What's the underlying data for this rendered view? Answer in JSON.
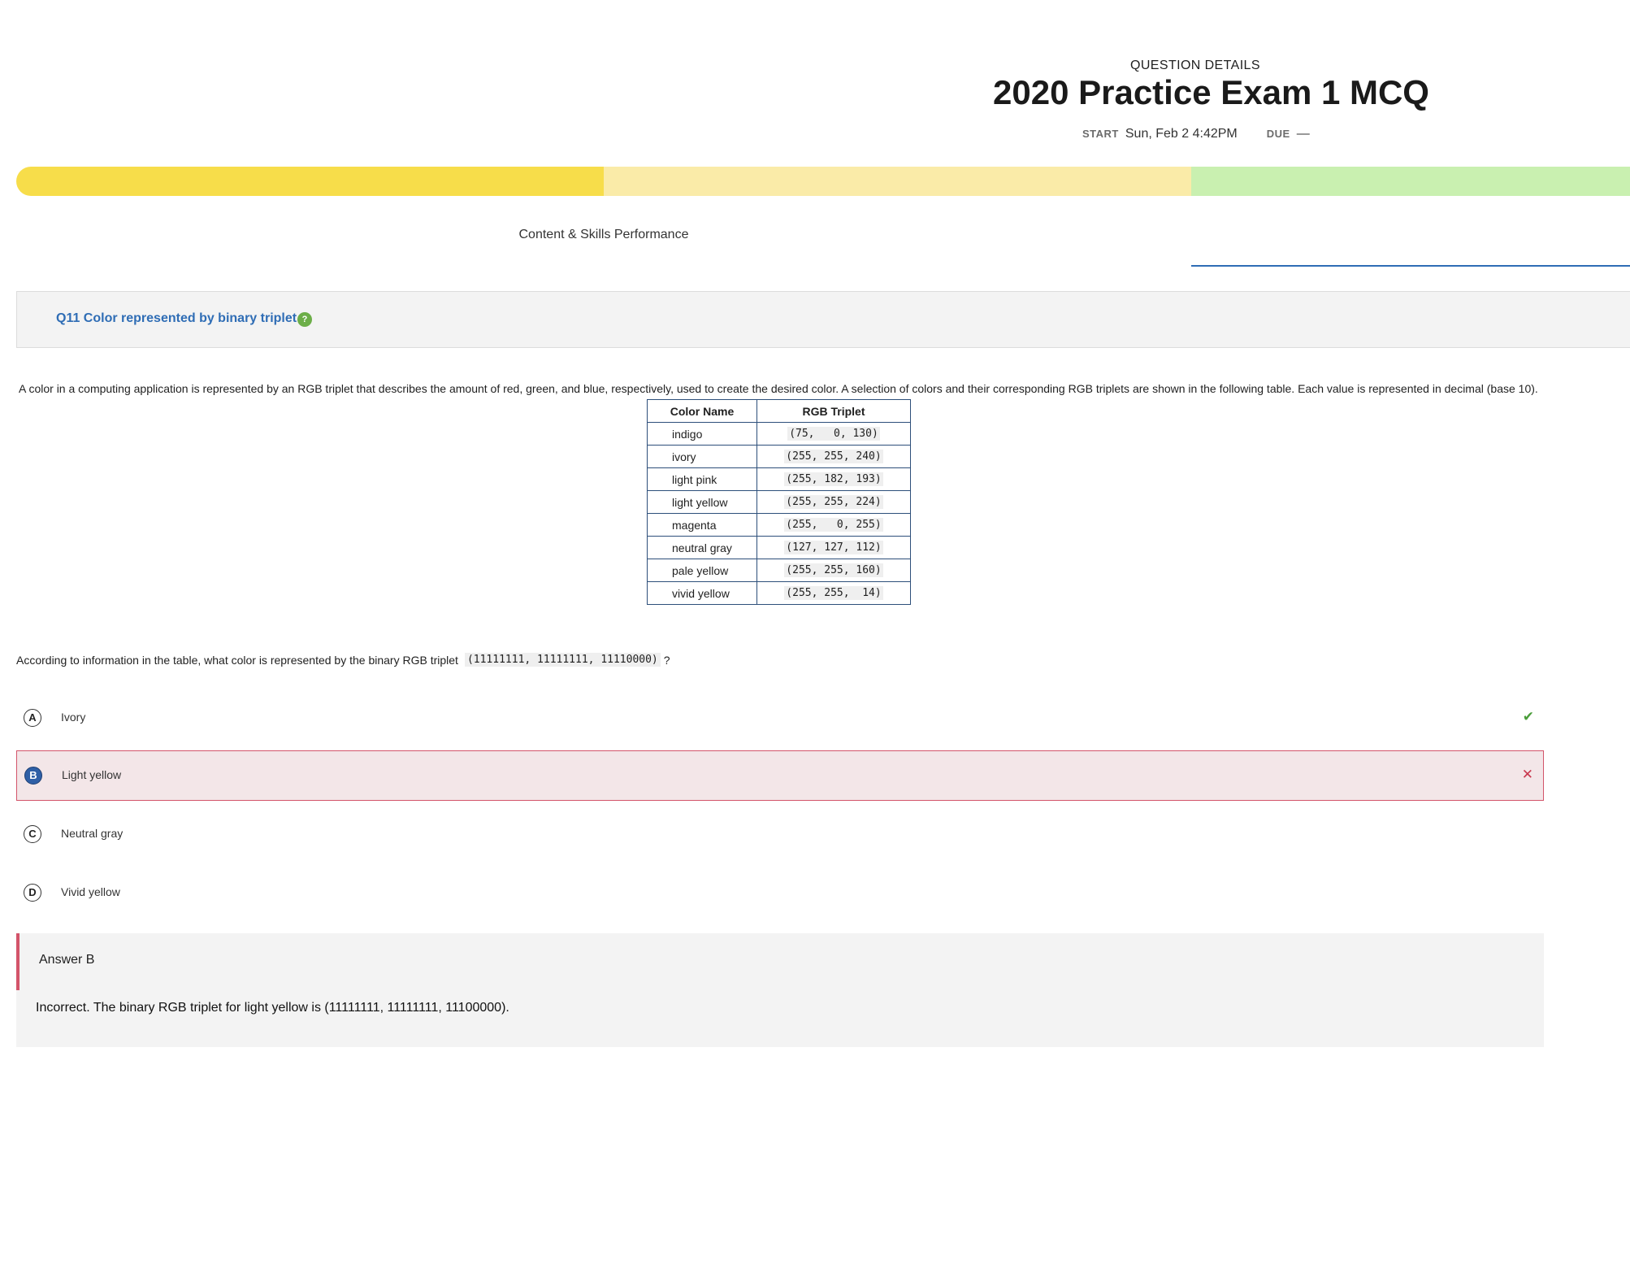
{
  "header": {
    "section_label": "QUESTION DETAILS",
    "title": "2020 Practice Exam 1 MCQ",
    "start_label": "START",
    "start_value": "Sun, Feb 2 4:42PM",
    "due_label": "DUE",
    "due_value": "—"
  },
  "progress": {
    "segments": [
      {
        "color": "#f7dd4a"
      },
      {
        "color": "#faeba8"
      },
      {
        "color": "#c9f0b0"
      }
    ]
  },
  "tabs": {
    "active_label": "Content & Skills Performance"
  },
  "question": {
    "title": "Q11 Color represented by binary triplet",
    "icon": "help-icon",
    "icon_glyph": "?",
    "stem": "A color in a computing application is represented by an RGB triplet that describes the amount of red, green, and blue, respectively, used to create the desired color. A selection of colors and their corresponding RGB triplets are shown in the following table. Each value is represented in decimal (base 10).",
    "table": {
      "headers": [
        "Color Name",
        "RGB Triplet"
      ],
      "rows": [
        [
          "indigo",
          "(75,   0, 130)"
        ],
        [
          "ivory",
          "(255, 255, 240)"
        ],
        [
          "light pink",
          "(255, 182, 193)"
        ],
        [
          "light yellow",
          "(255, 255, 224)"
        ],
        [
          "magenta",
          "(255,   0, 255)"
        ],
        [
          "neutral gray",
          "(127, 127, 112)"
        ],
        [
          "pale yellow",
          "(255, 255, 160)"
        ],
        [
          "vivid yellow",
          "(255, 255,  14)"
        ]
      ]
    },
    "prompt_prefix": "According to information in the table, what color is represented by the binary RGB triplet",
    "prompt_code": "(11111111, 11111111, 11110000)",
    "prompt_suffix": "?"
  },
  "choices": [
    {
      "letter": "A",
      "label": "Ivory",
      "mark": "✔",
      "mark_type": "correct"
    },
    {
      "letter": "B",
      "label": "Light yellow",
      "mark": "✕",
      "mark_type": "incorrect"
    },
    {
      "letter": "C",
      "label": "Neutral gray",
      "mark": "",
      "mark_type": ""
    },
    {
      "letter": "D",
      "label": "Vivid yellow",
      "mark": "",
      "mark_type": ""
    }
  ],
  "answer": {
    "heading": "Answer B",
    "text": "Incorrect. The binary RGB triplet for light yellow is  (11111111, 11111111, 11100000)."
  }
}
